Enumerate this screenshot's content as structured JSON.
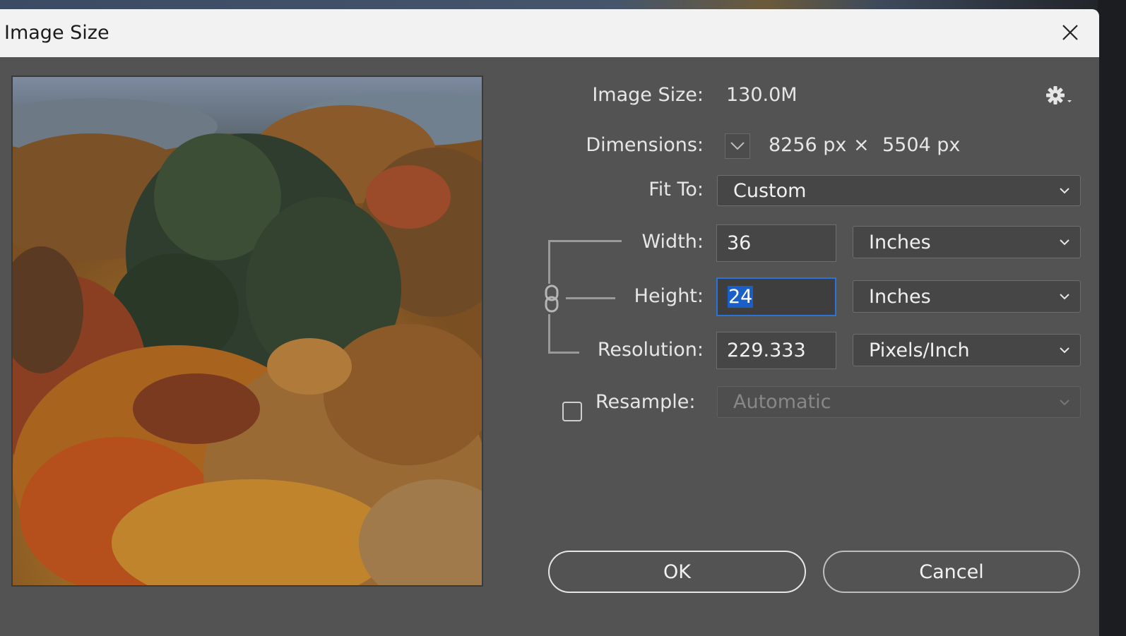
{
  "window": {
    "title": "Image Size"
  },
  "info": {
    "image_size_label": "Image Size:",
    "image_size_value": "130.0M",
    "dimensions_label": "Dimensions:",
    "width_px": "8256 px",
    "times": "×",
    "height_px": "5504 px"
  },
  "fit_to": {
    "label": "Fit To:",
    "value": "Custom"
  },
  "width": {
    "label": "Width:",
    "value": "36",
    "unit": "Inches"
  },
  "height": {
    "label": "Height:",
    "value": "24",
    "unit": "Inches"
  },
  "resolution": {
    "label": "Resolution:",
    "value": "229.333",
    "unit": "Pixels/Inch"
  },
  "resample": {
    "label": "Resample:",
    "value": "Automatic",
    "checked": false
  },
  "buttons": {
    "ok": "OK",
    "cancel": "Cancel"
  },
  "icons": [
    "close-icon",
    "gear-icon",
    "chevron-down-icon",
    "link-icon"
  ],
  "colors": {
    "dialog_bg": "#535353",
    "titlebar_bg": "#f2f2f2",
    "focus": "#2a73d9",
    "selection": "#1a5fc8"
  }
}
